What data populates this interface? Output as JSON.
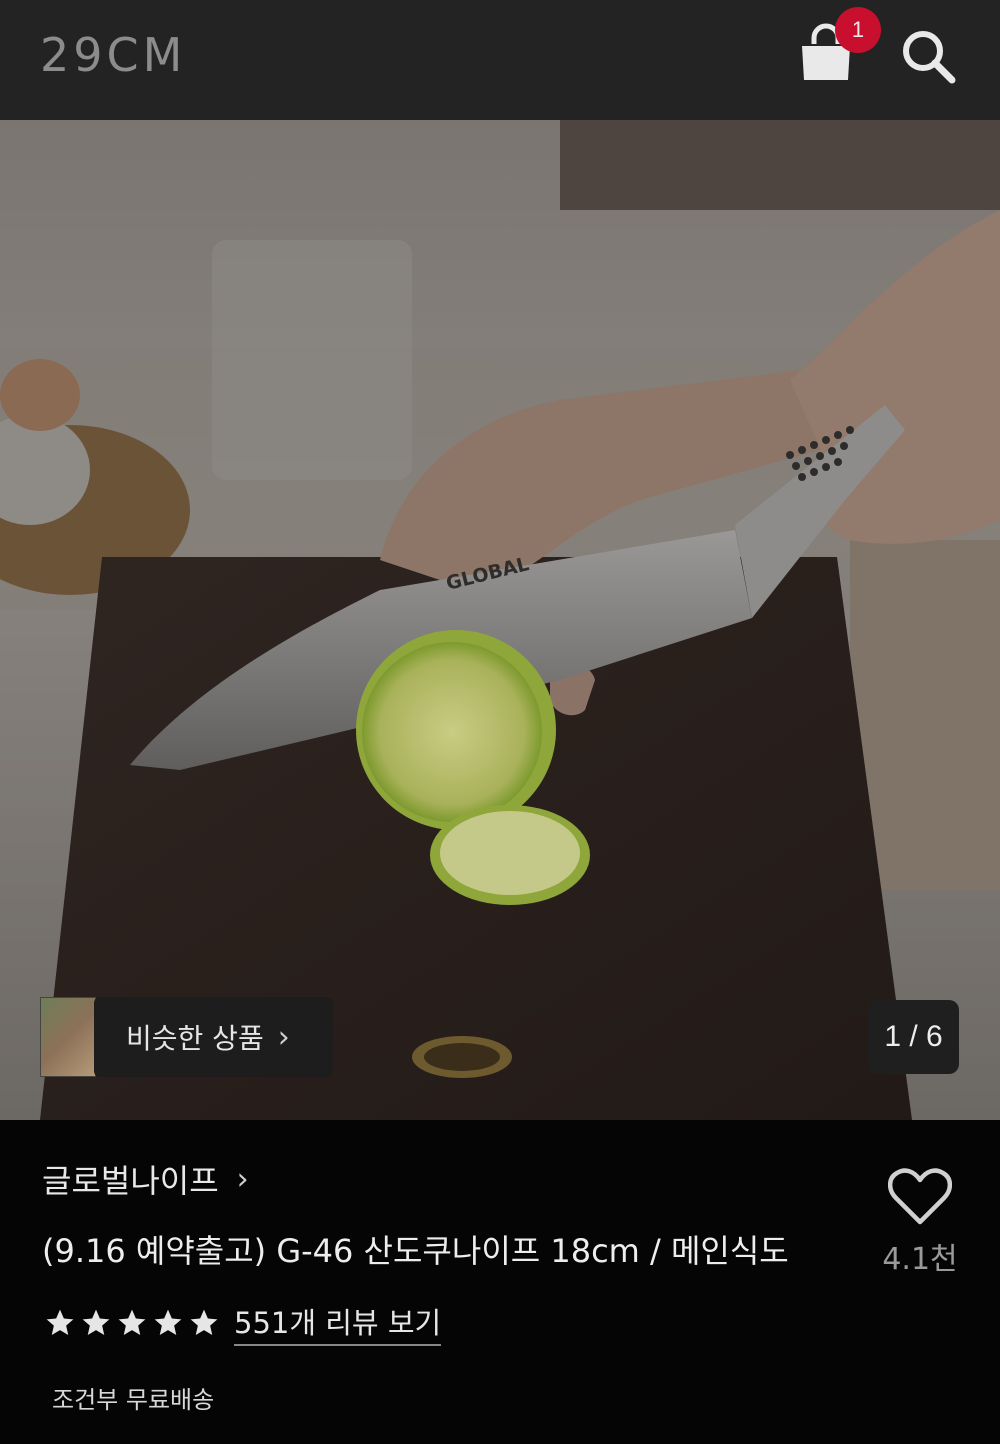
{
  "header": {
    "logo": "29CM",
    "cart_count": "1",
    "cart_icon": "shopping-bag-icon",
    "search_icon": "search-icon"
  },
  "gallery": {
    "similar_label": "비슷한 상품",
    "counter": "1 / 6",
    "knife_brand_print": "GLOBAL"
  },
  "product": {
    "brand": "글로벌나이프",
    "title": "(9.16 예약출고) G-46 산도쿠나이프 18cm / 메인식도",
    "like_count": "4.1천",
    "rating_stars": 5,
    "review_link": "551개 리뷰 보기",
    "shipping": "조건부 무료배송"
  },
  "colors": {
    "header_bg": "#232323",
    "badge": "#c8102e",
    "page_bg": "#050505"
  }
}
